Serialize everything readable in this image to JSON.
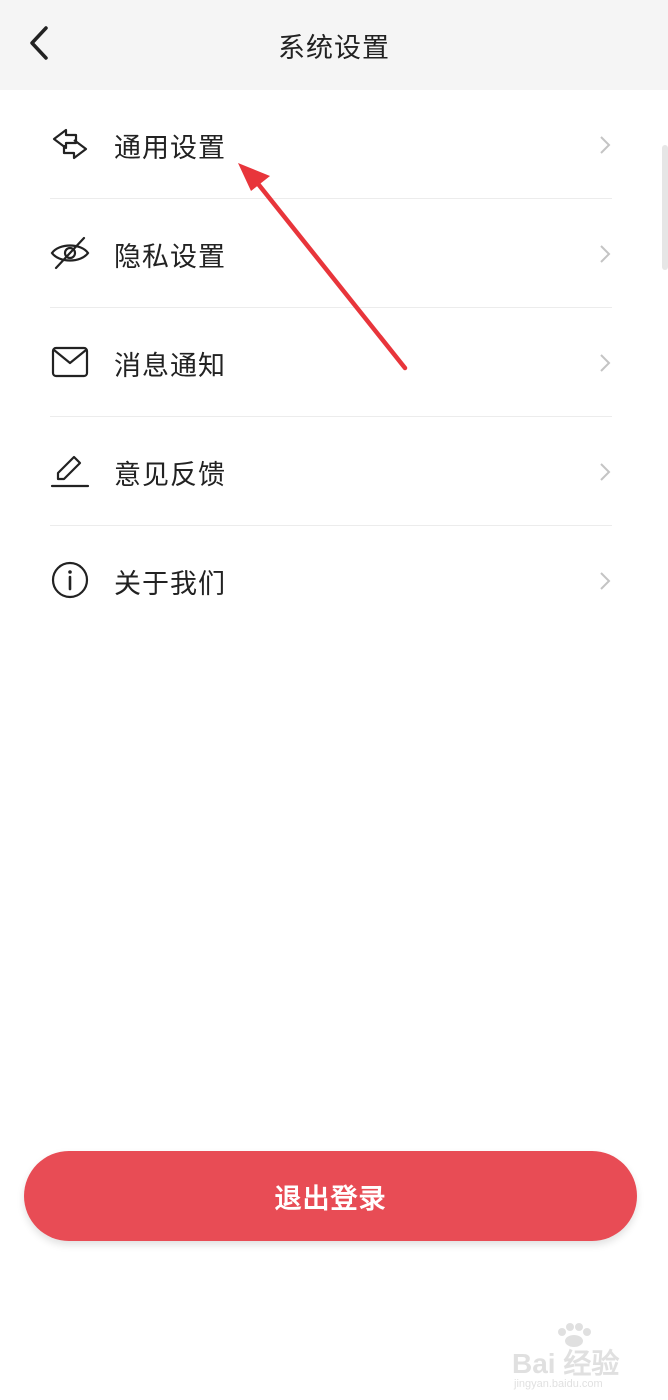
{
  "header": {
    "title": "系统设置",
    "back_icon": "chevron-left-icon"
  },
  "menu": {
    "items": [
      {
        "label": "通用设置",
        "icon": "swap-arrows-icon"
      },
      {
        "label": "隐私设置",
        "icon": "eye-off-icon"
      },
      {
        "label": "消息通知",
        "icon": "mail-icon"
      },
      {
        "label": "意见反馈",
        "icon": "pencil-icon"
      },
      {
        "label": "关于我们",
        "icon": "info-icon"
      }
    ]
  },
  "logout": {
    "label": "退出登录",
    "color": "#e84c55"
  },
  "annotation": {
    "arrow_color": "#e8353b"
  },
  "watermark": {
    "brand": "Bai 经验",
    "url": "jingyan.baidu.com"
  }
}
